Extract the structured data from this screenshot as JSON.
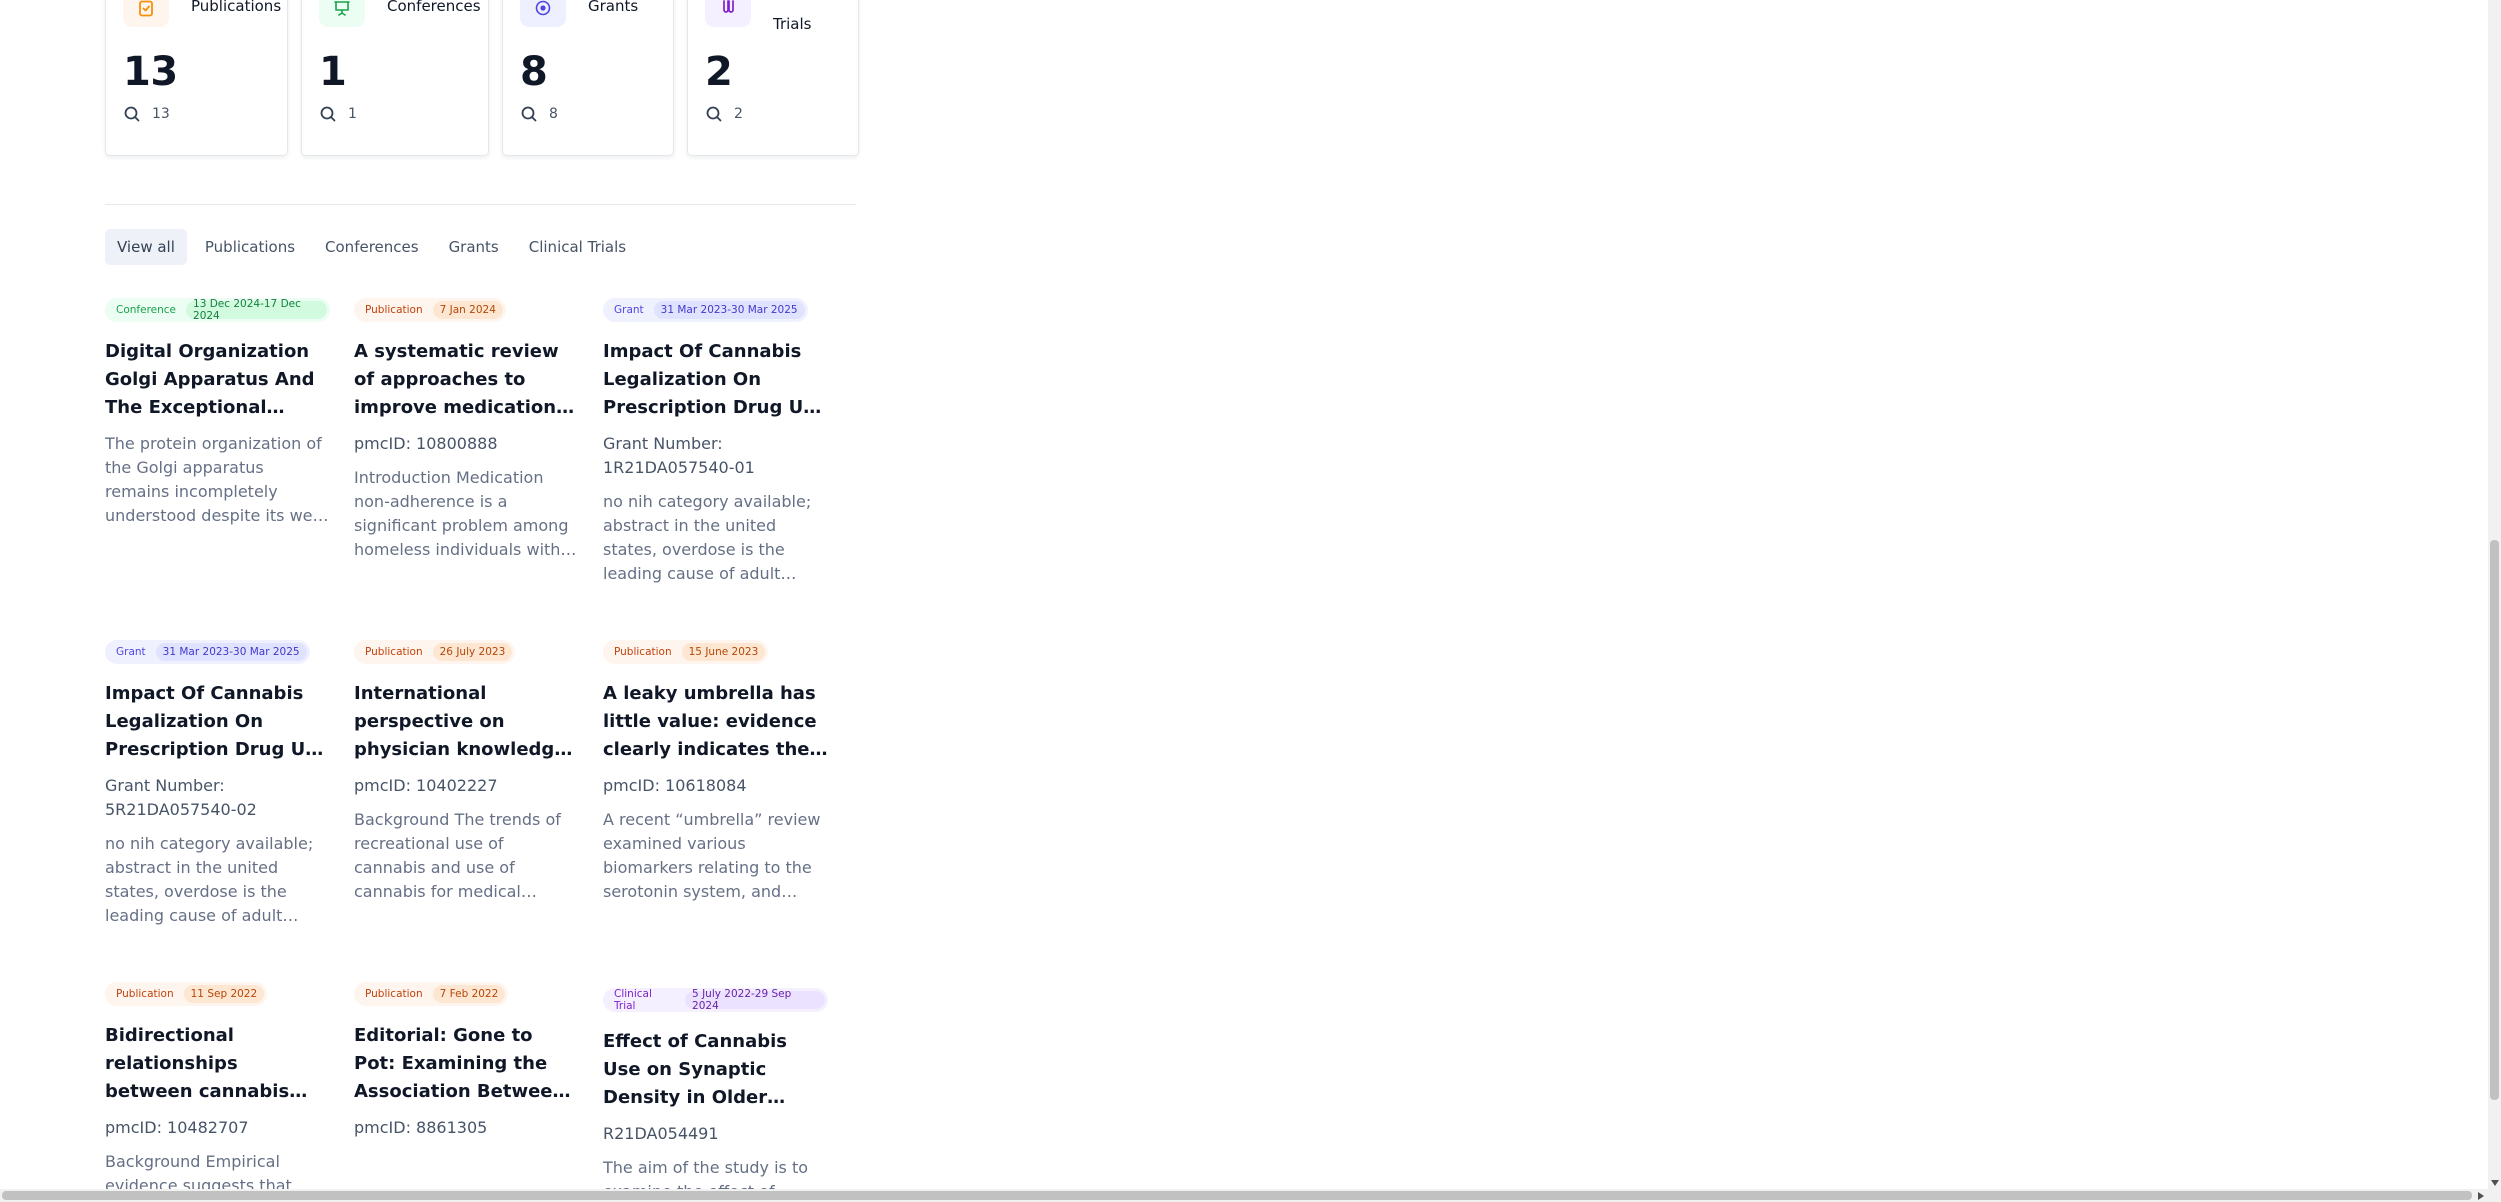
{
  "stats": [
    {
      "label": "Publications",
      "count": "13",
      "search_count": "13",
      "icon": "clipboard-check-icon",
      "color": "#f79009",
      "bg": "#fef6ee"
    },
    {
      "label": "Conferences",
      "count": "1",
      "search_count": "1",
      "icon": "presentation-icon",
      "color": "#16a34a",
      "bg": "#ecfdf3"
    },
    {
      "label": "Grants",
      "count": "8",
      "search_count": "8",
      "icon": "target-icon",
      "color": "#4f46e5",
      "bg": "#eef0ff"
    },
    {
      "label": "Trials",
      "count": "2",
      "search_count": "2",
      "icon": "test-tube-icon",
      "color": "#7e22ce",
      "bg": "#f5f0ff"
    }
  ],
  "tabs": [
    {
      "label": "View all",
      "active": true
    },
    {
      "label": "Publications"
    },
    {
      "label": "Conferences"
    },
    {
      "label": "Grants"
    },
    {
      "label": "Clinical Trials"
    }
  ],
  "items": [
    {
      "type": "Conference",
      "kind": "conf",
      "date": "13 Dec 2024-17 Dec 2024",
      "title": "Digital Organization Golgi Apparatus And The Exceptional Structural Diversity",
      "meta": "",
      "desc": "The protein organization of the Golgi apparatus remains incompletely understood despite its well-established importance."
    },
    {
      "type": "Publication",
      "kind": "pub",
      "date": "7 Jan 2024",
      "title": "A systematic review of approaches to improve medication adherence among homeless",
      "meta": "pmcID: 10800888",
      "desc": "Introduction Medication non-adherence is a significant problem among homeless individuals with psychiatric conditions."
    },
    {
      "type": "Grant",
      "kind": "grant",
      "date": "31 Mar 2023-30 Mar 2025",
      "title": "Impact Of Cannabis Legalization On Prescription Drug Use and Misuse",
      "meta": "Grant Number: 1R21DA057540-01",
      "desc": "no nih category available; abstract in the united states, overdose is the leading cause of adult deaths with opioids."
    },
    {
      "type": "Grant",
      "kind": "grant",
      "date": "31 Mar 2023-30 Mar 2025",
      "title": "Impact Of Cannabis Legalization On Prescription Drug Use and Misuse",
      "meta": "Grant Number: 5R21DA057540-02",
      "desc": "no nih category available; abstract in the united states, overdose is the leading cause of adult deaths with opioids."
    },
    {
      "type": "Publication",
      "kind": "pub",
      "date": "26 July 2023",
      "title": "International perspective on physician knowledge, attitudes and practices",
      "meta": "pmcID: 10402227",
      "desc": "Background The trends of recreational use of cannabis and use of cannabis for medical indications (i.e., medical use)."
    },
    {
      "type": "Publication",
      "kind": "pub",
      "date": "15 June 2023",
      "title": "A leaky umbrella has little value: evidence clearly indicates the serotonin system",
      "meta": "pmcID: 10618084",
      "desc": "A recent “umbrella” review examined various biomarkers relating to the serotonin system, and concluded there is no evidence."
    },
    {
      "type": "Publication",
      "kind": "pub",
      "date": "11 Sep 2022",
      "title": "Bidirectional relationships between cannabis use, anxiety and depressive symptoms",
      "meta": "pmcID: 10482707",
      "desc": "Background Empirical evidence suggests that"
    },
    {
      "type": "Publication",
      "kind": "pub",
      "date": "7 Feb 2022",
      "title": "Editorial: Gone to Pot: Examining the Association Between Cannabis and Psychosis",
      "meta": "pmcID: 8861305",
      "desc": ""
    },
    {
      "type": "Clinical Trial",
      "kind": "trial",
      "date": "5 July 2022-29 Sep 2024",
      "title": "Effect of Cannabis Use on Synaptic Density in Older Adults",
      "meta": "R21DA054491",
      "desc": "The aim of the study is to examine the effect of"
    }
  ]
}
